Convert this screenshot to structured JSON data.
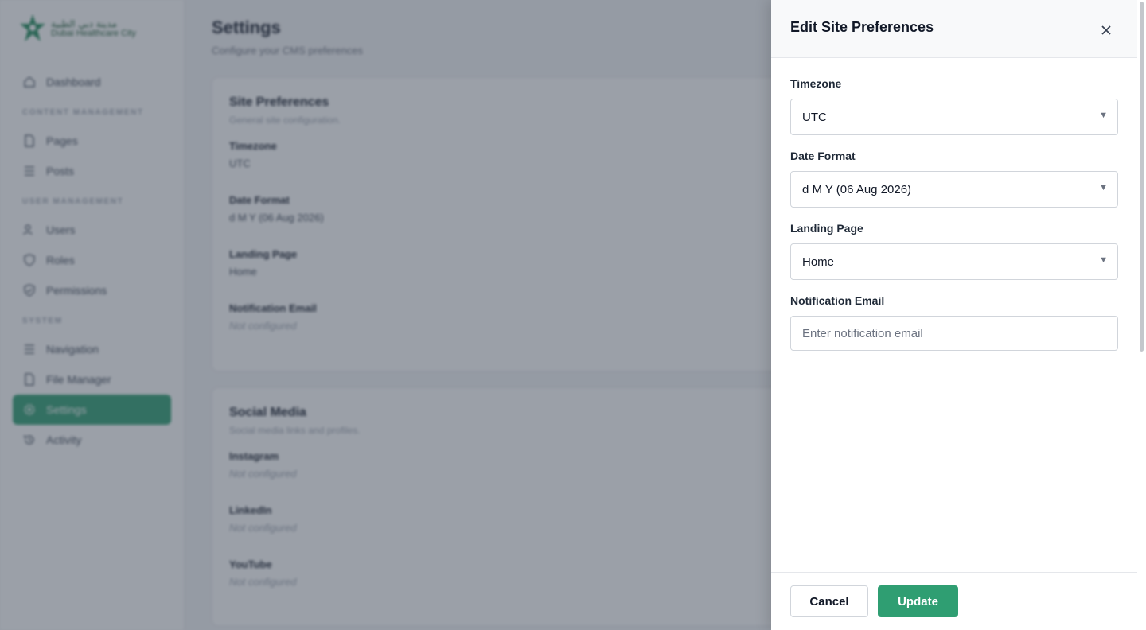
{
  "brand": {
    "name_ar": "مدينة دبي الطبية",
    "name_en": "Dubai Healthcare City",
    "accent": "#2f9e72"
  },
  "sidebar": {
    "items": [
      {
        "label": "Dashboard",
        "icon": "home-icon"
      },
      {
        "section": "CONTENT MANAGEMENT"
      },
      {
        "label": "Pages",
        "icon": "file-icon"
      },
      {
        "label": "Posts",
        "icon": "list-icon"
      },
      {
        "section": "USER MANAGEMENT"
      },
      {
        "label": "Users",
        "icon": "users-icon"
      },
      {
        "label": "Roles",
        "icon": "shield-icon"
      },
      {
        "label": "Permissions",
        "icon": "shield-check-icon"
      },
      {
        "section": "SYSTEM"
      },
      {
        "label": "Navigation",
        "icon": "menu-icon"
      },
      {
        "label": "File Manager",
        "icon": "file-icon"
      },
      {
        "label": "Settings",
        "icon": "gear-icon",
        "active": true
      },
      {
        "label": "Activity",
        "icon": "history-icon"
      }
    ]
  },
  "main": {
    "title": "Settings",
    "subtitle": "Configure your CMS preferences",
    "site_prefs": {
      "title": "Site Preferences",
      "subtitle": "General site configuration.",
      "fields": [
        {
          "label": "Timezone",
          "value": "UTC"
        },
        {
          "label": "Date Format",
          "value": "d M Y (06 Aug 2026)"
        },
        {
          "label": "Landing Page",
          "value": "Home"
        },
        {
          "label": "Notification Email",
          "value": "Not configured"
        }
      ]
    },
    "social": {
      "title": "Social Media",
      "subtitle": "Social media links and profiles.",
      "fields": [
        {
          "label": "Instagram",
          "value": "Not configured"
        },
        {
          "label": "LinkedIn",
          "value": "Not configured"
        },
        {
          "label": "YouTube",
          "value": "Not configured"
        }
      ]
    }
  },
  "drawer": {
    "title": "Edit Site Preferences",
    "timezone": {
      "label": "Timezone",
      "value": "UTC"
    },
    "date_format": {
      "label": "Date Format",
      "value": "d M Y (06 Aug 2026)"
    },
    "landing_page": {
      "label": "Landing Page",
      "value": "Home"
    },
    "notification_email": {
      "label": "Notification Email",
      "value": "",
      "placeholder": "Enter notification email"
    },
    "cancel_label": "Cancel",
    "update_label": "Update"
  }
}
